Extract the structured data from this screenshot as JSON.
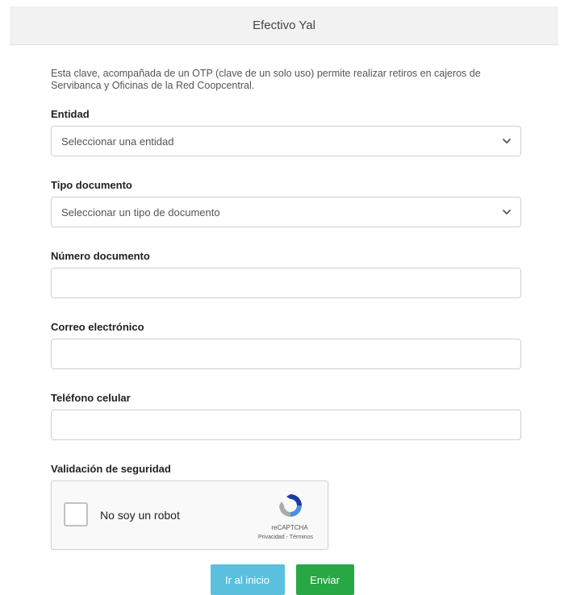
{
  "header": {
    "title": "Efectivo Yal"
  },
  "intro": "Esta clave, acompañada de un OTP (clave de un solo uso) permite realizar retiros en cajeros de Servibanca y Oficinas de la Red Coopcentral.",
  "fields": {
    "entidad": {
      "label": "Entidad",
      "value": "Seleccionar una entidad"
    },
    "tipo_documento": {
      "label": "Tipo documento",
      "value": "Seleccionar un tipo de documento"
    },
    "numero_documento": {
      "label": "Número documento",
      "value": ""
    },
    "correo": {
      "label": "Correo electrónico",
      "value": ""
    },
    "telefono": {
      "label": "Teléfono celular",
      "value": ""
    }
  },
  "security": {
    "label": "Validación de seguridad",
    "captcha_label": "No soy un robot",
    "brand": "reCAPTCHA",
    "terms": "Privacidad - Términos"
  },
  "buttons": {
    "home": "Ir al inicio",
    "send": "Enviar"
  },
  "icons": {
    "select_arrow": "chevron-down-icon",
    "captcha_logo": "recaptcha-icon"
  },
  "colors": {
    "home_button": "#5bc0de",
    "send_button": "#28a745"
  }
}
